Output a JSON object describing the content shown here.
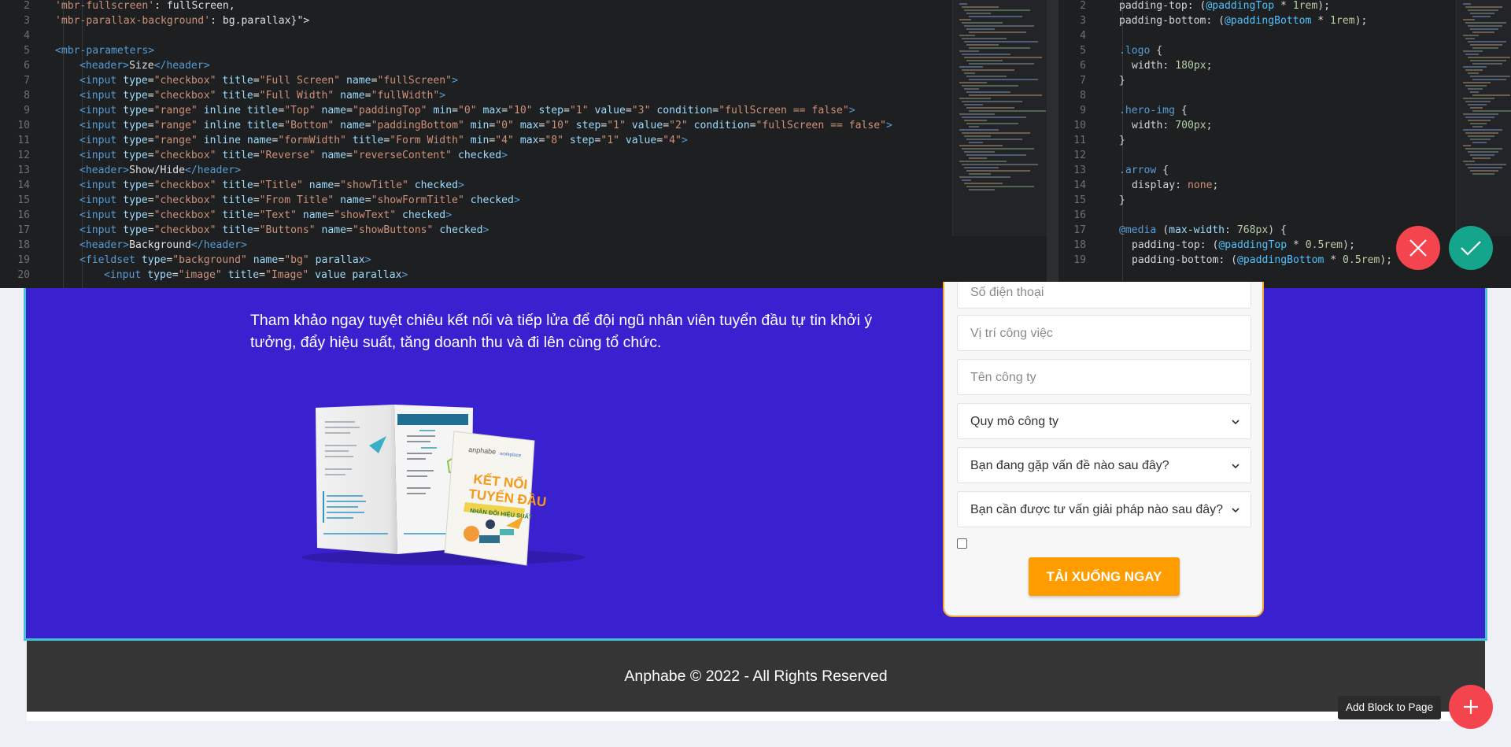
{
  "editor": {
    "html_lines": [
      {
        "n": "2",
        "indent": 0,
        "tokens": [
          [
            "t-str",
            "'mbr-fullscreen'"
          ],
          [
            "t-txt",
            ": fullScreen,"
          ]
        ]
      },
      {
        "n": "3",
        "indent": 0,
        "tokens": [
          [
            "t-str",
            "'mbr-parallax-background'"
          ],
          [
            "t-txt",
            ": bg.parallax}\">"
          ]
        ]
      },
      {
        "n": "4",
        "indent": 0,
        "tokens": []
      },
      {
        "n": "5",
        "indent": 0,
        "tokens": [
          [
            "t-tag",
            "<mbr-parameters>"
          ]
        ]
      },
      {
        "n": "6",
        "indent": 1,
        "tokens": [
          [
            "t-tag",
            "<header>"
          ],
          [
            "t-txt",
            "Size"
          ],
          [
            "t-tag",
            "</header>"
          ]
        ]
      },
      {
        "n": "7",
        "indent": 1,
        "tokens": [
          [
            "t-tag",
            "<input "
          ],
          [
            "t-attr",
            "type"
          ],
          [
            "t-txt",
            "="
          ],
          [
            "t-str",
            "\"checkbox\" "
          ],
          [
            "t-attr",
            "title"
          ],
          [
            "t-txt",
            "="
          ],
          [
            "t-str",
            "\"Full Screen\" "
          ],
          [
            "t-attr",
            "name"
          ],
          [
            "t-txt",
            "="
          ],
          [
            "t-str",
            "\"fullScreen\""
          ],
          [
            "t-tag",
            ">"
          ]
        ]
      },
      {
        "n": "8",
        "indent": 1,
        "tokens": [
          [
            "t-tag",
            "<input "
          ],
          [
            "t-attr",
            "type"
          ],
          [
            "t-txt",
            "="
          ],
          [
            "t-str",
            "\"checkbox\" "
          ],
          [
            "t-attr",
            "title"
          ],
          [
            "t-txt",
            "="
          ],
          [
            "t-str",
            "\"Full Width\" "
          ],
          [
            "t-attr",
            "name"
          ],
          [
            "t-txt",
            "="
          ],
          [
            "t-str",
            "\"fullWidth\""
          ],
          [
            "t-tag",
            ">"
          ]
        ]
      },
      {
        "n": "9",
        "indent": 1,
        "tokens": [
          [
            "t-tag",
            "<input "
          ],
          [
            "t-attr",
            "type"
          ],
          [
            "t-txt",
            "="
          ],
          [
            "t-str",
            "\"range\" "
          ],
          [
            "t-attr",
            "inline title"
          ],
          [
            "t-txt",
            "="
          ],
          [
            "t-str",
            "\"Top\" "
          ],
          [
            "t-attr",
            "name"
          ],
          [
            "t-txt",
            "="
          ],
          [
            "t-str",
            "\"paddingTop\" "
          ],
          [
            "t-attr",
            "min"
          ],
          [
            "t-txt",
            "="
          ],
          [
            "t-str",
            "\"0\" "
          ],
          [
            "t-attr",
            "max"
          ],
          [
            "t-txt",
            "="
          ],
          [
            "t-str",
            "\"10\" "
          ],
          [
            "t-attr",
            "step"
          ],
          [
            "t-txt",
            "="
          ],
          [
            "t-str",
            "\"1\" "
          ],
          [
            "t-attr",
            "value"
          ],
          [
            "t-txt",
            "="
          ],
          [
            "t-str",
            "\"3\" "
          ],
          [
            "t-attr",
            "condition"
          ],
          [
            "t-txt",
            "="
          ],
          [
            "t-str",
            "\"fullScreen == false\""
          ],
          [
            "t-tag",
            ">"
          ]
        ]
      },
      {
        "n": "10",
        "indent": 1,
        "tokens": [
          [
            "t-tag",
            "<input "
          ],
          [
            "t-attr",
            "type"
          ],
          [
            "t-txt",
            "="
          ],
          [
            "t-str",
            "\"range\" "
          ],
          [
            "t-attr",
            "inline title"
          ],
          [
            "t-txt",
            "="
          ],
          [
            "t-str",
            "\"Bottom\" "
          ],
          [
            "t-attr",
            "name"
          ],
          [
            "t-txt",
            "="
          ],
          [
            "t-str",
            "\"paddingBottom\" "
          ],
          [
            "t-attr",
            "min"
          ],
          [
            "t-txt",
            "="
          ],
          [
            "t-str",
            "\"0\" "
          ],
          [
            "t-attr",
            "max"
          ],
          [
            "t-txt",
            "="
          ],
          [
            "t-str",
            "\"10\" "
          ],
          [
            "t-attr",
            "step"
          ],
          [
            "t-txt",
            "="
          ],
          [
            "t-str",
            "\"1\" "
          ],
          [
            "t-attr",
            "value"
          ],
          [
            "t-txt",
            "="
          ],
          [
            "t-str",
            "\"2\" "
          ],
          [
            "t-attr",
            "condition"
          ],
          [
            "t-txt",
            "="
          ],
          [
            "t-str",
            "\"fullScreen == false\""
          ],
          [
            "t-tag",
            ">"
          ]
        ]
      },
      {
        "n": "11",
        "indent": 1,
        "tokens": [
          [
            "t-tag",
            "<input "
          ],
          [
            "t-attr",
            "type"
          ],
          [
            "t-txt",
            "="
          ],
          [
            "t-str",
            "\"range\" "
          ],
          [
            "t-attr",
            "inline name"
          ],
          [
            "t-txt",
            "="
          ],
          [
            "t-str",
            "\"formWidth\" "
          ],
          [
            "t-attr",
            "title"
          ],
          [
            "t-txt",
            "="
          ],
          [
            "t-str",
            "\"Form Width\" "
          ],
          [
            "t-attr",
            "min"
          ],
          [
            "t-txt",
            "="
          ],
          [
            "t-str",
            "\"4\" "
          ],
          [
            "t-attr",
            "max"
          ],
          [
            "t-txt",
            "="
          ],
          [
            "t-str",
            "\"8\" "
          ],
          [
            "t-attr",
            "step"
          ],
          [
            "t-txt",
            "="
          ],
          [
            "t-str",
            "\"1\" "
          ],
          [
            "t-attr",
            "value"
          ],
          [
            "t-txt",
            "="
          ],
          [
            "t-str",
            "\"4\""
          ],
          [
            "t-tag",
            ">"
          ]
        ]
      },
      {
        "n": "12",
        "indent": 1,
        "tokens": [
          [
            "t-tag",
            "<input "
          ],
          [
            "t-attr",
            "type"
          ],
          [
            "t-txt",
            "="
          ],
          [
            "t-str",
            "\"checkbox\" "
          ],
          [
            "t-attr",
            "title"
          ],
          [
            "t-txt",
            "="
          ],
          [
            "t-str",
            "\"Reverse\" "
          ],
          [
            "t-attr",
            "name"
          ],
          [
            "t-txt",
            "="
          ],
          [
            "t-str",
            "\"reverseContent\" "
          ],
          [
            "t-attr",
            "checked"
          ],
          [
            "t-tag",
            ">"
          ]
        ]
      },
      {
        "n": "13",
        "indent": 1,
        "tokens": [
          [
            "t-tag",
            "<header>"
          ],
          [
            "t-txt",
            "Show/Hide"
          ],
          [
            "t-tag",
            "</header>"
          ]
        ]
      },
      {
        "n": "14",
        "indent": 1,
        "tokens": [
          [
            "t-tag",
            "<input "
          ],
          [
            "t-attr",
            "type"
          ],
          [
            "t-txt",
            "="
          ],
          [
            "t-str",
            "\"checkbox\" "
          ],
          [
            "t-attr",
            "title"
          ],
          [
            "t-txt",
            "="
          ],
          [
            "t-str",
            "\"Title\" "
          ],
          [
            "t-attr",
            "name"
          ],
          [
            "t-txt",
            "="
          ],
          [
            "t-str",
            "\"showTitle\" "
          ],
          [
            "t-attr",
            "checked"
          ],
          [
            "t-tag",
            ">"
          ]
        ]
      },
      {
        "n": "15",
        "indent": 1,
        "tokens": [
          [
            "t-tag",
            "<input "
          ],
          [
            "t-attr",
            "type"
          ],
          [
            "t-txt",
            "="
          ],
          [
            "t-str",
            "\"checkbox\" "
          ],
          [
            "t-attr",
            "title"
          ],
          [
            "t-txt",
            "="
          ],
          [
            "t-str",
            "\"From Title\" "
          ],
          [
            "t-attr",
            "name"
          ],
          [
            "t-txt",
            "="
          ],
          [
            "t-str",
            "\"showFormTitle\" "
          ],
          [
            "t-attr",
            "checked"
          ],
          [
            "t-tag",
            ">"
          ]
        ]
      },
      {
        "n": "16",
        "indent": 1,
        "tokens": [
          [
            "t-tag",
            "<input "
          ],
          [
            "t-attr",
            "type"
          ],
          [
            "t-txt",
            "="
          ],
          [
            "t-str",
            "\"checkbox\" "
          ],
          [
            "t-attr",
            "title"
          ],
          [
            "t-txt",
            "="
          ],
          [
            "t-str",
            "\"Text\" "
          ],
          [
            "t-attr",
            "name"
          ],
          [
            "t-txt",
            "="
          ],
          [
            "t-str",
            "\"showText\" "
          ],
          [
            "t-attr",
            "checked"
          ],
          [
            "t-tag",
            ">"
          ]
        ]
      },
      {
        "n": "17",
        "indent": 1,
        "tokens": [
          [
            "t-tag",
            "<input "
          ],
          [
            "t-attr",
            "type"
          ],
          [
            "t-txt",
            "="
          ],
          [
            "t-str",
            "\"checkbox\" "
          ],
          [
            "t-attr",
            "title"
          ],
          [
            "t-txt",
            "="
          ],
          [
            "t-str",
            "\"Buttons\" "
          ],
          [
            "t-attr",
            "name"
          ],
          [
            "t-txt",
            "="
          ],
          [
            "t-str",
            "\"showButtons\" "
          ],
          [
            "t-attr",
            "checked"
          ],
          [
            "t-tag",
            ">"
          ]
        ]
      },
      {
        "n": "18",
        "indent": 1,
        "tokens": [
          [
            "t-tag",
            "<header>"
          ],
          [
            "t-txt",
            "Background"
          ],
          [
            "t-tag",
            "</header>"
          ]
        ]
      },
      {
        "n": "19",
        "indent": 1,
        "tokens": [
          [
            "t-tag",
            "<fieldset "
          ],
          [
            "t-attr",
            "type"
          ],
          [
            "t-txt",
            "="
          ],
          [
            "t-str",
            "\"background\" "
          ],
          [
            "t-attr",
            "name"
          ],
          [
            "t-txt",
            "="
          ],
          [
            "t-str",
            "\"bg\" "
          ],
          [
            "t-attr",
            "parallax"
          ],
          [
            "t-tag",
            ">"
          ]
        ]
      },
      {
        "n": "20",
        "indent": 2,
        "tokens": [
          [
            "t-tag",
            "<input "
          ],
          [
            "t-attr",
            "type"
          ],
          [
            "t-txt",
            "="
          ],
          [
            "t-str",
            "\"image\" "
          ],
          [
            "t-attr",
            "title"
          ],
          [
            "t-txt",
            "="
          ],
          [
            "t-str",
            "\"Image\" "
          ],
          [
            "t-attr",
            "value parallax"
          ],
          [
            "t-tag",
            ">"
          ]
        ]
      }
    ],
    "css_lines": [
      {
        "n": "2",
        "indent": 0,
        "tokens": [
          [
            "t-prop",
            "padding-top: ("
          ],
          [
            "t-var",
            "@paddingTop"
          ],
          [
            "t-prop",
            " * "
          ],
          [
            "t-num",
            "1rem"
          ],
          [
            "t-prop",
            ");"
          ]
        ]
      },
      {
        "n": "3",
        "indent": 0,
        "tokens": [
          [
            "t-prop",
            "padding-bottom: ("
          ],
          [
            "t-var",
            "@paddingBottom"
          ],
          [
            "t-prop",
            " * "
          ],
          [
            "t-num",
            "1rem"
          ],
          [
            "t-prop",
            ");"
          ]
        ]
      },
      {
        "n": "4",
        "indent": 0,
        "tokens": []
      },
      {
        "n": "5",
        "indent": 0,
        "tokens": [
          [
            "t-sel",
            ".logo"
          ],
          [
            "t-prop",
            " {"
          ]
        ]
      },
      {
        "n": "6",
        "indent": 1,
        "tokens": [
          [
            "t-prop",
            "width: "
          ],
          [
            "t-num",
            "180px"
          ],
          [
            "t-prop",
            ";"
          ]
        ]
      },
      {
        "n": "7",
        "indent": 0,
        "tokens": [
          [
            "t-prop",
            "}"
          ]
        ]
      },
      {
        "n": "8",
        "indent": 0,
        "tokens": []
      },
      {
        "n": "9",
        "indent": 0,
        "tokens": [
          [
            "t-sel",
            ".hero-img"
          ],
          [
            "t-prop",
            " {"
          ]
        ]
      },
      {
        "n": "10",
        "indent": 1,
        "tokens": [
          [
            "t-prop",
            "width: "
          ],
          [
            "t-num",
            "700px"
          ],
          [
            "t-prop",
            ";"
          ]
        ]
      },
      {
        "n": "11",
        "indent": 0,
        "tokens": [
          [
            "t-prop",
            "}"
          ]
        ]
      },
      {
        "n": "12",
        "indent": 0,
        "tokens": []
      },
      {
        "n": "13",
        "indent": 0,
        "tokens": [
          [
            "t-sel",
            ".arrow"
          ],
          [
            "t-prop",
            " {"
          ]
        ]
      },
      {
        "n": "14",
        "indent": 1,
        "tokens": [
          [
            "t-prop",
            "display: "
          ],
          [
            "t-str",
            "none"
          ],
          [
            "t-prop",
            ";"
          ]
        ]
      },
      {
        "n": "15",
        "indent": 0,
        "tokens": [
          [
            "t-prop",
            "}"
          ]
        ]
      },
      {
        "n": "16",
        "indent": 0,
        "tokens": []
      },
      {
        "n": "17",
        "indent": 0,
        "tokens": [
          [
            "t-sel",
            "@media"
          ],
          [
            "t-prop",
            " ("
          ],
          [
            "t-attr",
            "max-width"
          ],
          [
            "t-prop",
            ": "
          ],
          [
            "t-num",
            "768px"
          ],
          [
            "t-prop",
            ") {"
          ]
        ]
      },
      {
        "n": "18",
        "indent": 1,
        "tokens": [
          [
            "t-prop",
            "padding-top: ("
          ],
          [
            "t-var",
            "@paddingTop"
          ],
          [
            "t-prop",
            " * "
          ],
          [
            "t-num",
            "0.5rem"
          ],
          [
            "t-prop",
            ");"
          ]
        ]
      },
      {
        "n": "19",
        "indent": 1,
        "tokens": [
          [
            "t-prop",
            "padding-bottom: ("
          ],
          [
            "t-var",
            "@paddingBottom"
          ],
          [
            "t-prop",
            " * "
          ],
          [
            "t-num",
            "0.5rem"
          ],
          [
            "t-prop",
            ");"
          ]
        ]
      }
    ]
  },
  "hero": {
    "lead_text": "Tham khảo ngay tuyệt chiêu kết nối và tiếp lửa để đội ngũ nhân viên tuyển đầu tự tin khởi ý tưởng, đẩy hiệu suất, tăng doanh thu và đi lên cùng tổ chức.",
    "book_brand": "anphabe",
    "book_partner": "workplace",
    "book_title_1": "KẾT NỐI",
    "book_title_2": "TUYẾN ĐẦU",
    "book_subtitle": "NHÂN ĐÔI HIỆU SUẤT"
  },
  "form": {
    "phone_placeholder": "Số điện thoại",
    "position_placeholder": "Vị trí công việc",
    "company_placeholder": "Tên công ty",
    "company_size_selected": "Quy mô công ty",
    "problem_selected": "Bạn đang gặp vấn đề nào sau đây?",
    "solution_selected": "Bạn cần được tư vấn giải pháp nào sau đây?",
    "submit_label": "TẢI XUỐNG NGAY"
  },
  "footer": {
    "copyright": "Anphabe © 2022 - All Rights Reserved"
  },
  "controls": {
    "add_block_label": "Add Block to Page"
  },
  "colors": {
    "hero_bg": "#3a21cf",
    "cta": "#ff9d00",
    "cancel": "#f4454f",
    "apply": "#15a58d",
    "footer_bg": "#353535",
    "editor_bg": "#1e1f21"
  }
}
